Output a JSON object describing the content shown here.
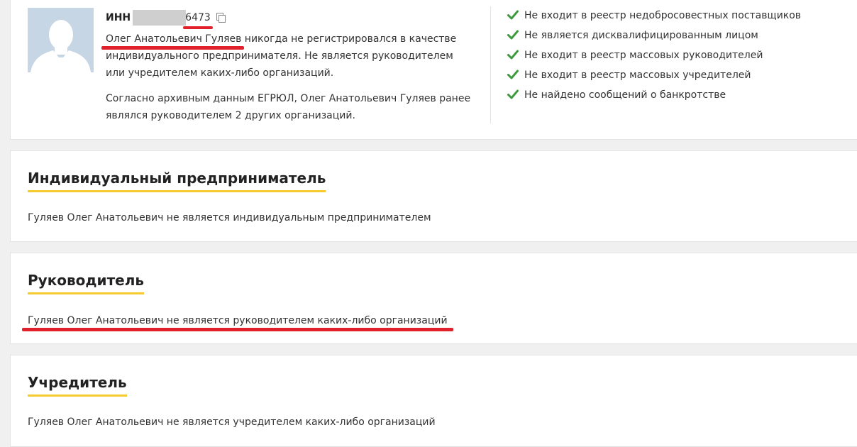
{
  "profile": {
    "inn_label": "ИНН",
    "inn_suffix": "6473",
    "name_highlight": "Олег Анатольевич Гуляев",
    "para1_rest": " никогда не регистрировался в качестве индивидуального предпринимателя. Не является руководителем или учредителем каких-либо организаций.",
    "para2": "Согласно архивным данным ЕГРЮЛ, Олег Анатольевич Гуляев ранее являлся руководителем 2 других организаций."
  },
  "checks": [
    {
      "label": "Не входит в реестр недобросовестных поставщиков",
      "icon": "check-icon"
    },
    {
      "label": "Не является дисквалифицированным лицом",
      "icon": "check-icon"
    },
    {
      "label": "Не входит в реестр массовых руководителей",
      "icon": "check-icon"
    },
    {
      "label": "Не входит в реестр массовых учредителей",
      "icon": "check-icon"
    },
    {
      "label": "Не найдено сообщений о банкротстве",
      "icon": "check-icon"
    }
  ],
  "sections": {
    "ip": {
      "title": "Индивидуальный предприниматель",
      "text": "Гуляев Олег Анатольевич не является индивидуальным предпринимателем"
    },
    "manager": {
      "title": "Руководитель",
      "text": "Гуляев Олег Анатольевич не является руководителем каких-либо организаций"
    },
    "founder": {
      "title": "Учредитель",
      "text": "Гуляев Олег Анатольевич не является учредителем каких-либо организаций"
    }
  },
  "colors": {
    "accent_underline": "#f5cb2e",
    "check_green": "#3d9a3d",
    "annotation_red": "#e0212b"
  }
}
